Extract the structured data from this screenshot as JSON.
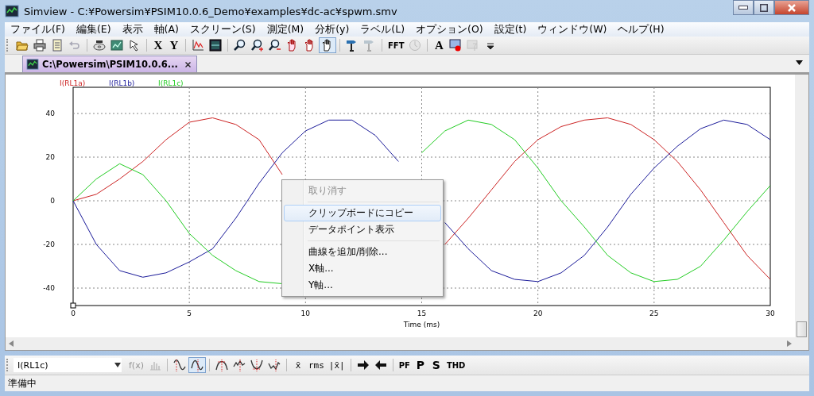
{
  "window": {
    "title": "Simview - C:¥Powersim¥PSIM10.0.6_Demo¥examples¥dc-ac¥spwm.smv"
  },
  "menu": [
    "ファイル(F)",
    "編集(E)",
    "表示",
    "軸(A)",
    "スクリーン(S)",
    "測定(M)",
    "分析(y)",
    "ラベル(L)",
    "オプション(O)",
    "設定(t)",
    "ウィンドウ(W)",
    "ヘルプ(H)"
  ],
  "toolbar": {
    "items": [
      {
        "kind": "icon",
        "disabled": false,
        "selected": false
      },
      {
        "kind": "icon",
        "disabled": false,
        "selected": false
      },
      {
        "kind": "icon",
        "disabled": false,
        "selected": false
      },
      {
        "kind": "icon",
        "disabled": true,
        "selected": false
      },
      {
        "kind": "separator"
      },
      {
        "kind": "icon",
        "disabled": false,
        "selected": false
      },
      {
        "kind": "icon",
        "disabled": false,
        "selected": false
      },
      {
        "kind": "icon",
        "disabled": false,
        "selected": false
      },
      {
        "kind": "separator"
      },
      {
        "kind": "text",
        "label": "X",
        "disabled": false,
        "selected": false
      },
      {
        "kind": "text",
        "label": "Y",
        "disabled": false,
        "selected": false
      },
      {
        "kind": "separator"
      },
      {
        "kind": "icon",
        "disabled": false,
        "selected": false
      },
      {
        "kind": "icon",
        "disabled": false,
        "selected": false
      },
      {
        "kind": "separator"
      },
      {
        "kind": "icon",
        "disabled": false,
        "selected": false
      },
      {
        "kind": "icon",
        "disabled": false,
        "selected": false
      },
      {
        "kind": "icon",
        "disabled": false,
        "selected": false
      },
      {
        "kind": "icon",
        "disabled": false,
        "selected": false
      },
      {
        "kind": "icon",
        "disabled": false,
        "selected": false
      },
      {
        "kind": "icon",
        "disabled": false,
        "selected": true
      },
      {
        "kind": "separator"
      },
      {
        "kind": "icon",
        "disabled": false,
        "selected": false
      },
      {
        "kind": "icon",
        "disabled": true,
        "selected": false
      },
      {
        "kind": "separator"
      },
      {
        "kind": "text",
        "label": "FFT",
        "disabled": false,
        "selected": false
      },
      {
        "kind": "icon",
        "disabled": true,
        "selected": false
      },
      {
        "kind": "separator"
      },
      {
        "kind": "text",
        "label": "A",
        "disabled": false,
        "selected": false
      },
      {
        "kind": "icon",
        "disabled": false,
        "selected": false
      },
      {
        "kind": "icon",
        "disabled": true,
        "selected": false
      },
      {
        "kind": "icon",
        "disabled": false,
        "selected": false
      }
    ]
  },
  "tabs": [
    {
      "label": "C:\\Powersim\\PSIM10.0.6...",
      "selected": true
    }
  ],
  "chart": {
    "chart_data": {
      "type": "line",
      "xlabel": "Time (ms)",
      "x": [
        0,
        1,
        2,
        3,
        4,
        5,
        6,
        7,
        8,
        9,
        10,
        11,
        12,
        13,
        14,
        15,
        16,
        17,
        18,
        19,
        20,
        21,
        22,
        23,
        24,
        25,
        26,
        27,
        28,
        29,
        30
      ],
      "xlim": [
        0,
        30
      ],
      "ylim": [
        -48,
        52
      ],
      "grid": true,
      "xticks": [
        0,
        5,
        10,
        15,
        20,
        25,
        30
      ],
      "yticks": [
        -40,
        -20,
        0,
        20,
        40
      ],
      "series": [
        {
          "name": "I(RL1a)",
          "color": "#cc2222",
          "values": [
            0,
            3,
            10,
            18,
            28,
            36,
            38,
            35,
            28,
            12,
            null,
            null,
            null,
            null,
            null,
            null,
            -20,
            -8,
            5,
            18,
            28,
            34,
            37,
            38,
            35,
            28,
            18,
            5,
            -10,
            -25,
            -36
          ]
        },
        {
          "name": "I(RL1b)",
          "color": "#1a1a99",
          "values": [
            0,
            -20,
            -32,
            -35,
            -33,
            -28,
            -22,
            -8,
            8,
            22,
            32,
            37,
            37,
            30,
            18,
            null,
            -10,
            -22,
            -32,
            -36,
            -37,
            -33,
            -25,
            -12,
            3,
            15,
            25,
            33,
            37,
            35,
            28
          ]
        },
        {
          "name": "I(RL1c)",
          "color": "#22cc22",
          "values": [
            0,
            10,
            17,
            12,
            0,
            -15,
            -25,
            -32,
            -37,
            -38,
            null,
            null,
            null,
            null,
            null,
            22,
            32,
            37,
            35,
            28,
            15,
            0,
            -12,
            -25,
            -33,
            -37,
            -36,
            -30,
            -18,
            -5,
            7
          ]
        }
      ]
    }
  },
  "context_menu": {
    "items": [
      {
        "kind": "item",
        "label": "取り消す",
        "disabled": true,
        "selected": false
      },
      {
        "kind": "separator"
      },
      {
        "kind": "item",
        "label": "クリップボードにコピー",
        "disabled": false,
        "selected": true
      },
      {
        "kind": "item",
        "label": "データポイント表示",
        "disabled": false,
        "selected": false
      },
      {
        "kind": "separator"
      },
      {
        "kind": "item",
        "label": "曲線を追加/削除...",
        "disabled": false,
        "selected": false
      },
      {
        "kind": "item",
        "label": "X軸...",
        "disabled": false,
        "selected": false
      },
      {
        "kind": "item",
        "label": "Y軸...",
        "disabled": false,
        "selected": false
      }
    ]
  },
  "bottom_toolbar": {
    "items": [
      {
        "kind": "select",
        "value": "I(RL1c)"
      },
      {
        "kind": "text",
        "label": "f(x)",
        "disabled": true,
        "selected": false
      },
      {
        "kind": "icon",
        "disabled": true,
        "selected": false
      },
      {
        "kind": "separator"
      },
      {
        "kind": "icon",
        "disabled": false,
        "selected": false
      },
      {
        "kind": "icon",
        "disabled": false,
        "selected": true
      },
      {
        "kind": "separator"
      },
      {
        "kind": "icon",
        "disabled": false,
        "selected": false
      },
      {
        "kind": "icon",
        "disabled": false,
        "selected": false
      },
      {
        "kind": "icon",
        "disabled": false,
        "selected": false
      },
      {
        "kind": "icon",
        "disabled": false,
        "selected": false
      },
      {
        "kind": "separator"
      },
      {
        "kind": "text",
        "label": "x̄",
        "disabled": false,
        "selected": false
      },
      {
        "kind": "text",
        "label": "rms",
        "disabled": false,
        "selected": false
      },
      {
        "kind": "text",
        "label": "|x̄|",
        "disabled": false,
        "selected": false
      },
      {
        "kind": "separator"
      },
      {
        "kind": "icon",
        "disabled": false,
        "selected": false
      },
      {
        "kind": "icon",
        "disabled": false,
        "selected": false
      },
      {
        "kind": "separator"
      },
      {
        "kind": "text",
        "label": "PF",
        "disabled": false,
        "selected": false
      },
      {
        "kind": "text",
        "label": "P",
        "disabled": false,
        "selected": false
      },
      {
        "kind": "text",
        "label": "S",
        "disabled": false,
        "selected": false
      },
      {
        "kind": "text",
        "label": "THD",
        "disabled": false,
        "selected": false
      }
    ]
  },
  "status_bar": {
    "text": "準備中"
  }
}
